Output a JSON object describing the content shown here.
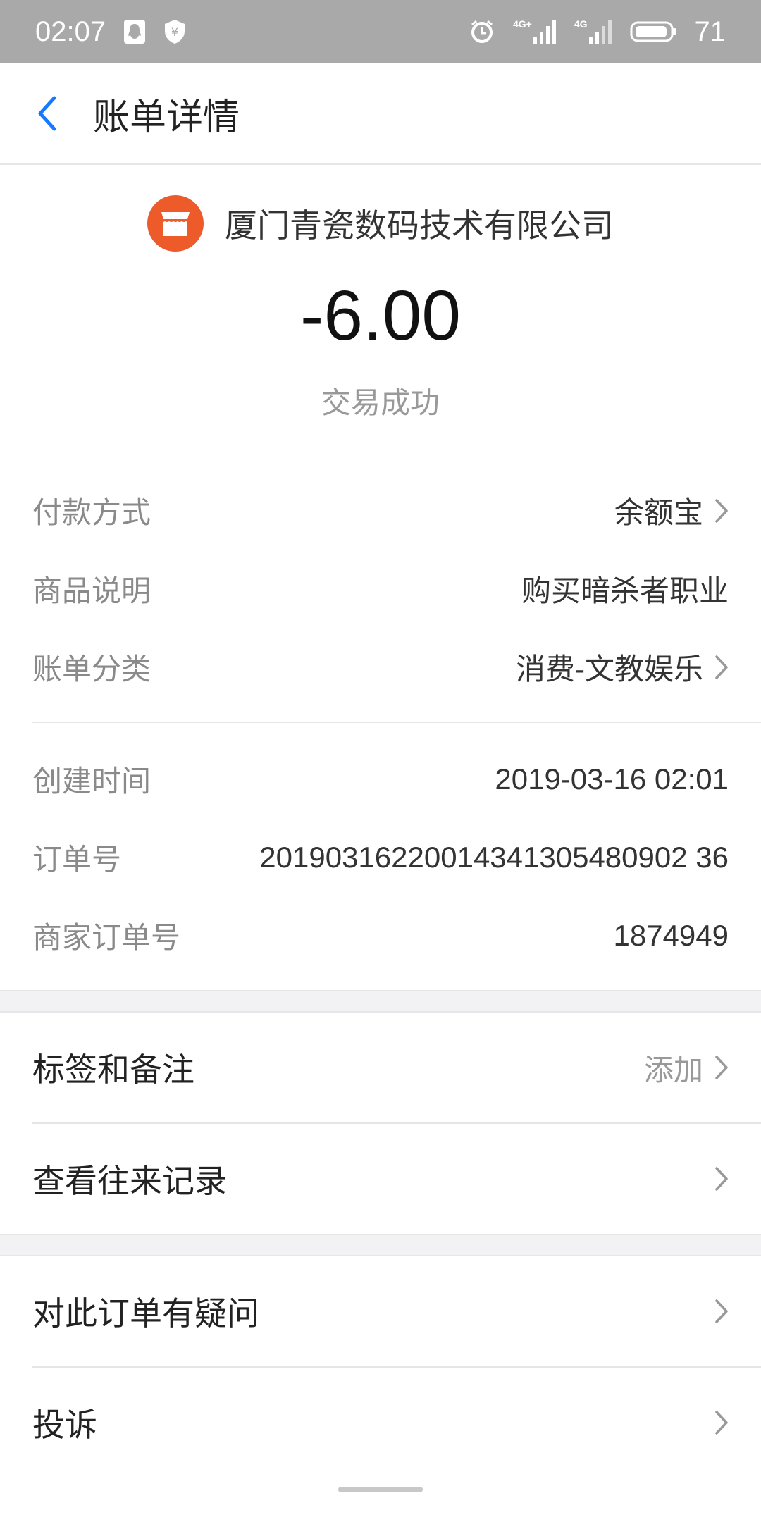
{
  "status_bar": {
    "time": "02:07",
    "battery": "71",
    "signal1_label": "4G+",
    "signal2_label": "4G",
    "icons": [
      "qq-icon",
      "shield-icon",
      "alarm-icon",
      "signal-icon",
      "battery-icon"
    ]
  },
  "header": {
    "title": "账单详情"
  },
  "merchant": {
    "name": "厦门青瓷数码技术有限公司",
    "logo_color": "#ee5b2a"
  },
  "amount": "-6.00",
  "status": "交易成功",
  "details": {
    "payment_method": {
      "label": "付款方式",
      "value": "余额宝"
    },
    "description": {
      "label": "商品说明",
      "value": "购买暗杀者职业"
    },
    "category": {
      "label": "账单分类",
      "value": "消费-文教娱乐"
    },
    "created": {
      "label": "创建时间",
      "value": "2019-03-16 02:01"
    },
    "order_no": {
      "label": "订单号",
      "value": "20190316220014341305480902 36"
    },
    "merchant_order_no": {
      "label": "商家订单号",
      "value": "1874949"
    }
  },
  "actions": {
    "tags_notes": {
      "label": "标签和备注",
      "hint": "添加"
    },
    "history": {
      "label": "查看往来记录"
    },
    "question": {
      "label": "对此订单有疑问"
    },
    "complaint": {
      "label": "投诉"
    }
  },
  "colors": {
    "accent_blue": "#1677ff",
    "merchant_orange": "#ee5b2a"
  }
}
